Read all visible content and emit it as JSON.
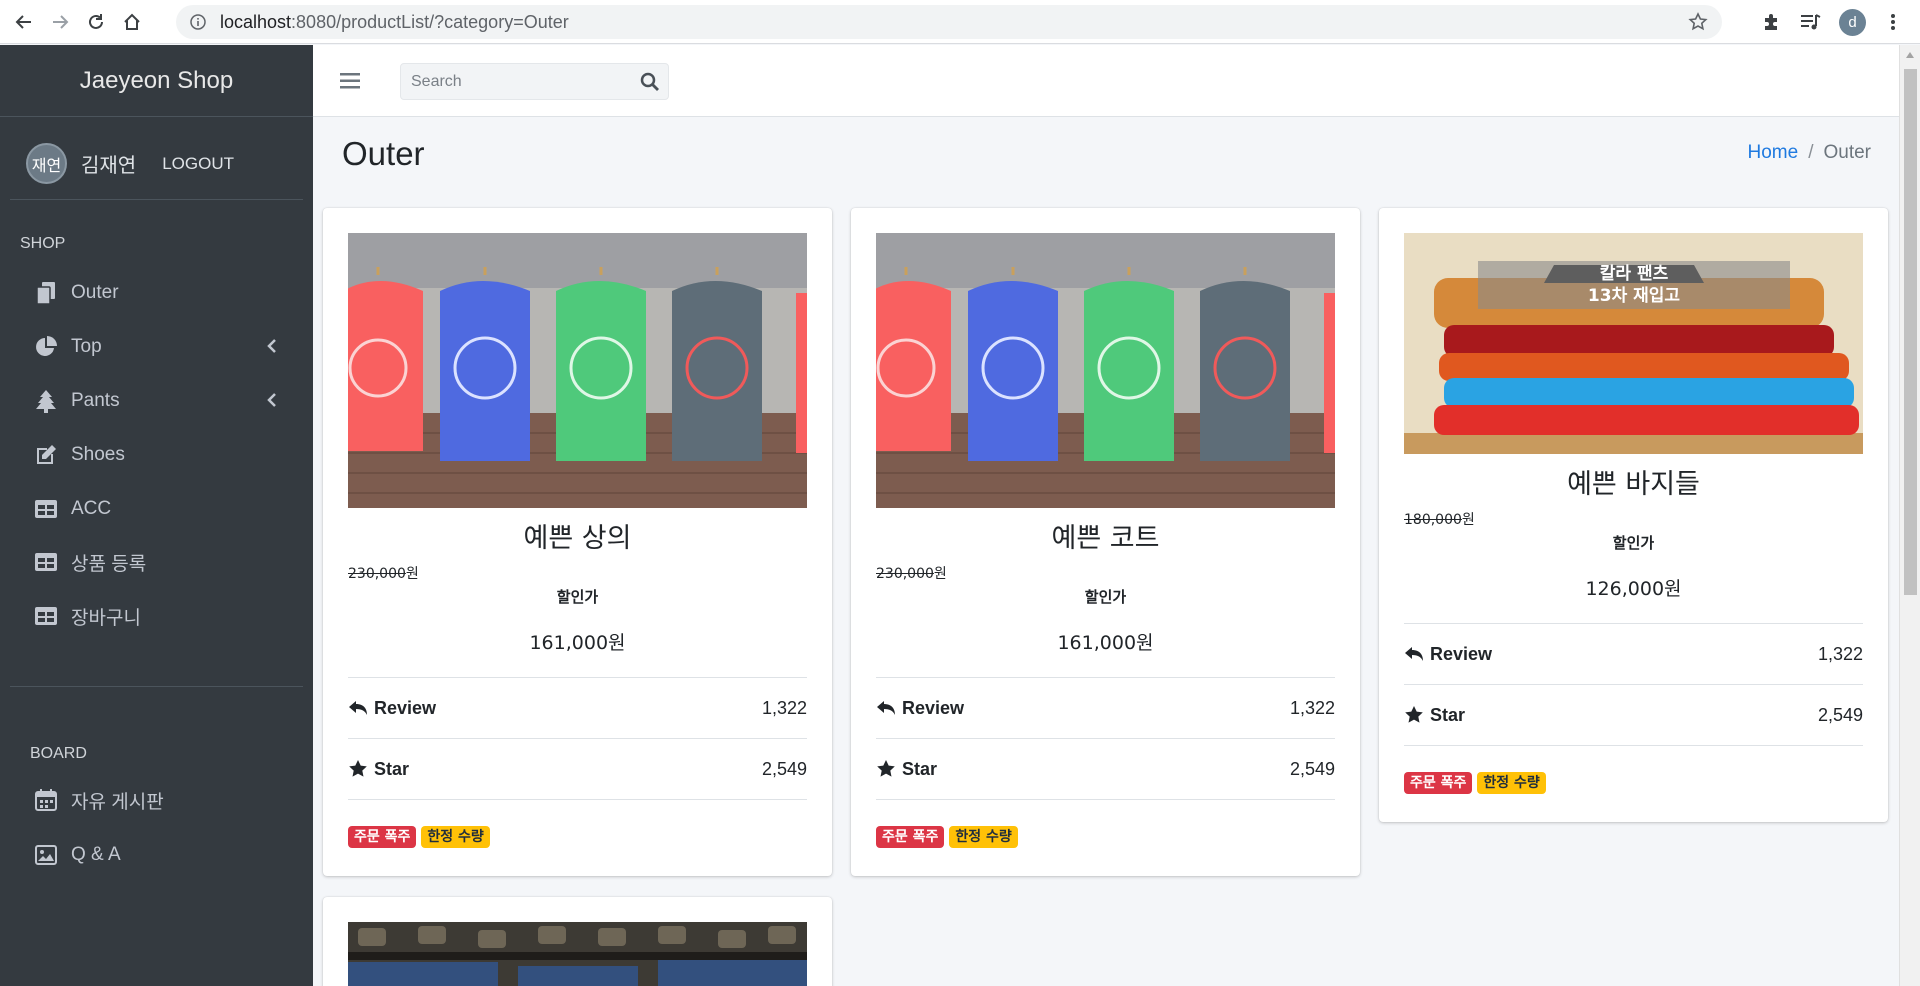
{
  "browser": {
    "url_host": "localhost",
    "url_rest": ":8080/productList/?category=Outer",
    "profile_initial": "d"
  },
  "sidebar": {
    "brand": "Jaeyeon Shop",
    "user": {
      "avatar_text": "재연",
      "name": "김재연",
      "logout": "LOGOUT"
    },
    "shop_header": "SHOP",
    "shop_items": [
      {
        "label": "Outer",
        "icon": "copy-icon"
      },
      {
        "label": "Top",
        "icon": "pie-chart-icon",
        "has_children": true
      },
      {
        "label": "Pants",
        "icon": "tree-icon",
        "has_children": true
      },
      {
        "label": "Shoes",
        "icon": "edit-icon"
      },
      {
        "label": "ACC",
        "icon": "table-icon"
      },
      {
        "label": "상품 등록",
        "icon": "table-icon"
      },
      {
        "label": "장바구니",
        "icon": "table-icon"
      }
    ],
    "board_header": "BOARD",
    "board_items": [
      {
        "label": "자유 게시판",
        "icon": "calendar-icon"
      },
      {
        "label": "Q & A",
        "icon": "image-icon"
      }
    ]
  },
  "topbar": {
    "search_placeholder": "Search"
  },
  "content": {
    "title": "Outer",
    "breadcrumb": {
      "home": "Home",
      "current": "Outer"
    }
  },
  "products": [
    {
      "name": "예쁜 상의",
      "original_price": "230,000",
      "won": "원",
      "sale_label": "할인가",
      "sale_price": "161,000원",
      "review_label": "Review",
      "review_count": "1,322",
      "star_label": "Star",
      "star_count": "2,549",
      "badges": [
        "주문 폭주",
        "한정 수량"
      ]
    },
    {
      "name": "예쁜 코트",
      "original_price": "230,000",
      "won": "원",
      "sale_label": "할인가",
      "sale_price": "161,000원",
      "review_label": "Review",
      "review_count": "1,322",
      "star_label": "Star",
      "star_count": "2,549",
      "badges": [
        "주문 폭주",
        "한정 수량"
      ]
    },
    {
      "name": "예쁜 바지들",
      "original_price": "180,000",
      "won": "원",
      "sale_label": "할인가",
      "sale_price": "126,000원",
      "review_label": "Review",
      "review_count": "1,322",
      "star_label": "Star",
      "star_count": "2,549",
      "badges": [
        "주문 폭주",
        "한정 수량"
      ],
      "image_overlay_line1": "칼라 팬츠",
      "image_overlay_line2": "13차 재입고"
    }
  ],
  "colors": {
    "sidebar_bg": "#343a40",
    "link": "#1f7ae0",
    "badge_red": "#dc3545",
    "badge_yellow": "#ffc107"
  }
}
